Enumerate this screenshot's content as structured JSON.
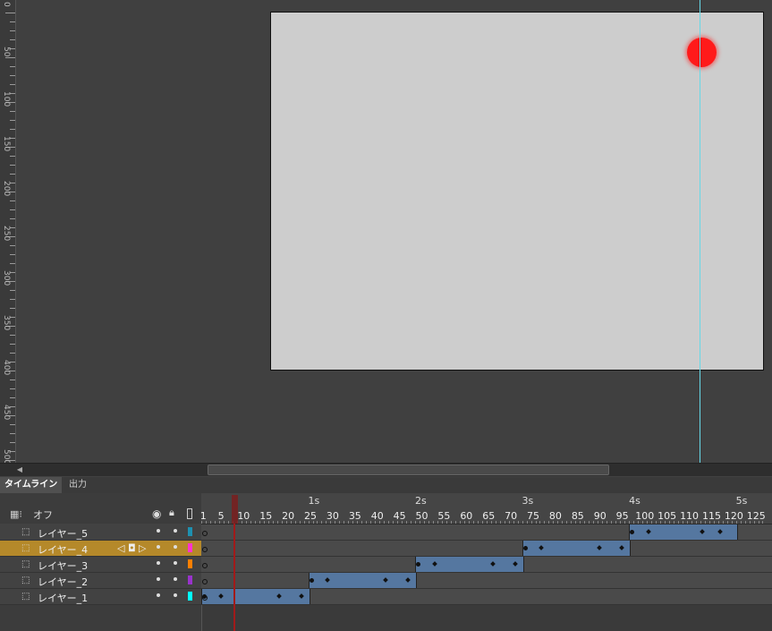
{
  "rulerV": [
    "0",
    "50",
    "100",
    "150",
    "200",
    "250",
    "300",
    "350",
    "400",
    "450",
    "500"
  ],
  "tabs": {
    "timeline": "タイムライン",
    "output": "出力"
  },
  "timeline": {
    "onion_label": "オフ",
    "seconds": [
      "1s",
      "2s",
      "3s",
      "4s",
      "5s"
    ],
    "frames": [
      "1",
      "5",
      "10",
      "15",
      "20",
      "25",
      "30",
      "35",
      "40",
      "45",
      "50",
      "55",
      "60",
      "65",
      "70",
      "75",
      "80",
      "85",
      "90",
      "95",
      "100",
      "105",
      "110",
      "115",
      "120",
      "125"
    ]
  },
  "layers": [
    {
      "name": "レイヤー_5",
      "color": "#1e90b0",
      "selected": false
    },
    {
      "name": "レイヤー_4",
      "color": "#ff33cc",
      "selected": true
    },
    {
      "name": "レイヤー_3",
      "color": "#ff8000",
      "selected": false
    },
    {
      "name": "レイヤー_2",
      "color": "#9933cc",
      "selected": false
    },
    {
      "name": "レイヤー_1",
      "color": "#00ffff",
      "selected": false
    }
  ],
  "colors": {
    "stage": "#cdcdcd",
    "ball": "#ff1a1a",
    "guide": "#66d9e8",
    "tween": "#5577a0",
    "selection": "#b5892a",
    "playhead": "#a11a1a"
  }
}
